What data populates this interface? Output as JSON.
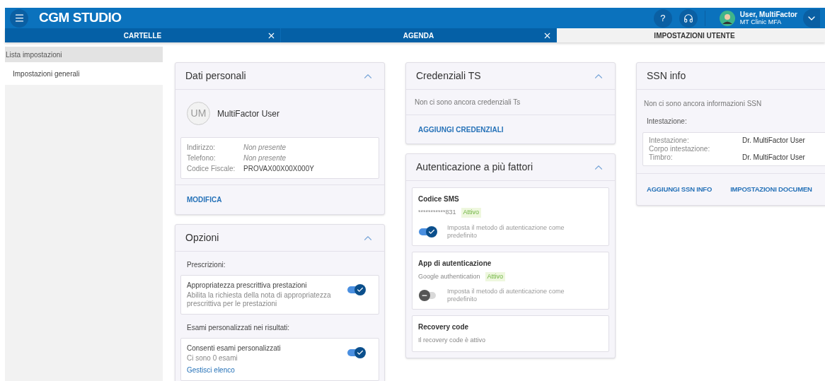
{
  "header": {
    "app_title": "CGM STUDIO",
    "help": "?",
    "user": {
      "name": "User, MultiFactor",
      "clinic": "MT Clinic MFA"
    }
  },
  "tabs": [
    {
      "label": "CARTELLE",
      "selected": false,
      "closable": true
    },
    {
      "label": "AGENDA",
      "selected": false,
      "closable": true
    },
    {
      "label": "IMPOSTAZIONI UTENTE",
      "selected": true,
      "closable": false
    }
  ],
  "sidebar": {
    "title": "Lista impostazioni",
    "items": [
      {
        "label": "Impostazioni generali",
        "selected": true
      }
    ]
  },
  "dati_personali": {
    "title": "Dati personali",
    "expanded": true,
    "initials": "UM",
    "name": "MultiFactor User",
    "fields": [
      {
        "label": "Indirizzo:",
        "value": "Non presente",
        "missing": true
      },
      {
        "label": "Telefono:",
        "value": "Non presente",
        "missing": true
      },
      {
        "label": "Codice Fiscale:",
        "value": "PROVAX00X00X000Y",
        "missing": false
      }
    ],
    "action": "MODIFICA"
  },
  "opzioni": {
    "title": "Opzioni",
    "expanded": true,
    "sections": [
      {
        "heading": "Prescrizioni:",
        "option": {
          "title": "Appropriatezza prescrittiva prestazioni",
          "description": "Abilita la richiesta della nota di appropriatezza prescrittiva per le prestazioni",
          "on": true
        }
      },
      {
        "heading": "Esami personalizzati nei risultati:",
        "option": {
          "title": "Consenti esami personalizzati",
          "description": "Ci sono 0 esami",
          "link": "Gestisci elenco",
          "on": true
        }
      }
    ]
  },
  "credenziali_ts": {
    "title": "Credenziali TS",
    "expanded": true,
    "message": "Non ci sono ancora credenziali Ts",
    "action": "AGGIUNGI CREDENZIALI"
  },
  "mfa": {
    "title": "Autenticazione a più fattori",
    "expanded": true,
    "methods": [
      {
        "kind": "toggle",
        "name": "Codice SMS",
        "detail": "***********831",
        "status": "Attivo",
        "default_label": "Imposta il metodo di autenticazione come predefinito",
        "on": true
      },
      {
        "kind": "toggle",
        "name": "App di autenticazione",
        "detail": "Google authentication",
        "status": "Attivo",
        "default_label": "Imposta il metodo di autenticazione come predefinito",
        "on": false
      },
      {
        "kind": "info",
        "name": "Recovery code",
        "detail": "Il recovery code è attivo"
      }
    ]
  },
  "ssn_info": {
    "title": "SSN info",
    "message": "Non ci sono ancora informazioni SSN",
    "heading": "Intestazione:",
    "fields": [
      {
        "label": "Intestazione:",
        "value": "Dr. MultiFactor User"
      },
      {
        "label": "Corpo intestazione:"
      },
      {
        "label": "Timbro:",
        "value": "Dr. MultiFactor User"
      }
    ],
    "actions": [
      "AGGIUNGI SSN INFO",
      "IMPOSTAZIONI DOCUMEN"
    ]
  }
}
